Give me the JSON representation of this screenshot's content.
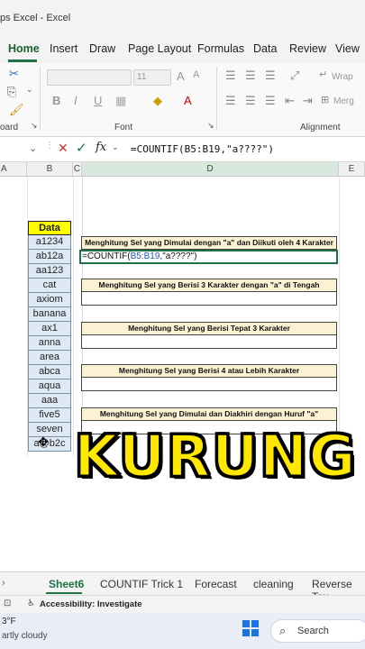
{
  "window": {
    "title": "ps Excel  -  Excel"
  },
  "ribbon": {
    "tabs": [
      "Home",
      "Insert",
      "Draw",
      "Page Layout",
      "Formulas",
      "Data",
      "Review",
      "View"
    ],
    "font_size": "11",
    "groups": {
      "clipboard": "oard",
      "font": "Font",
      "alignment": "Alignment"
    },
    "wrap_label": "Wrap",
    "merge_label": "Merg",
    "font_buttons": [
      "B",
      "I",
      "U"
    ]
  },
  "formula_bar": {
    "formula": "=COUNTIF(B5:B19,\"a????\")",
    "fx": "fx"
  },
  "columns": [
    "A",
    "B",
    "C",
    "D",
    "E"
  ],
  "data_column": {
    "header": "Data",
    "values": [
      "a1234",
      "ab12a",
      "aa123",
      "cat",
      "axiom",
      "banana",
      "ax1",
      "anna",
      "area",
      "abca",
      "aqua",
      "aaa",
      "five5",
      "seven",
      "a@b2c"
    ]
  },
  "questions": [
    "Menghitung Sel yang Dimulai dengan \"a\" dan Diikuti oleh 4 Karakter",
    "Menghitung Sel yang Berisi 3 Karakter dengan \"a\" di Tengah",
    "Menghitung Sel yang Berisi Tepat 3 Karakter",
    "Menghitung Sel yang Berisi 4 atau Lebih Karakter",
    "Menghitung Sel yang Dimulai dan Diakhiri dengan Huruf \"a\""
  ],
  "active_cell": {
    "prefix": "=COUNTIF(",
    "ref": "B5:B19",
    "suffix": ",\"a????\")"
  },
  "overlay_text": "KURUNG",
  "sheets": [
    "Sheet6",
    "COUNTIF Trick 1",
    "Forecast",
    "cleaning",
    "Reverse Tex"
  ],
  "status": {
    "accessibility": "Accessibility: Investigate"
  },
  "taskbar": {
    "weather_temp": "3°F",
    "weather_desc": "artly cloudy",
    "search_label": "Search"
  },
  "colors": {
    "excel_green": "#1e7145",
    "data_header": "#ffff00",
    "overlay": "#ffe800"
  }
}
